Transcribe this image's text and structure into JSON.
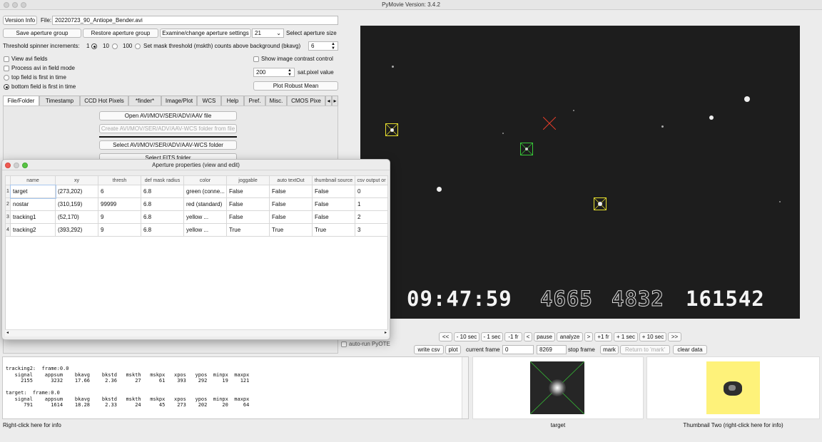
{
  "window": {
    "title": "PyMovie  Version: 3.4.2"
  },
  "top": {
    "version_info_btn": "Version Info",
    "file_label": "File:",
    "file_value": "20220723_90_Antiope_Bender.avi",
    "save_group_btn": "Save aperture group",
    "restore_group_btn": "Restore aperture group",
    "examine_btn": "Examine/change aperture settings",
    "aperture_size_value": "21",
    "aperture_size_label": "Select aperture size",
    "spinner_label": "Threshold spinner increments:",
    "spinner_options": [
      "1",
      "10",
      "100"
    ],
    "spinner_selected": "10",
    "mask_label": "Set mask threshold (mskth) counts above background (bkavg)",
    "mask_value": "6",
    "view_avi_fields": "View avi fields",
    "process_field_mode": "Process avi in field mode",
    "top_field_first": "top field is first in time",
    "bottom_field_first": "bottom field is first in time",
    "show_contrast": "Show image contrast control",
    "sat_value": "200",
    "sat_label": "sat.pixel value",
    "robust_mean_btn": "Plot Robust Mean"
  },
  "tabs": [
    "File/Folder",
    "Timestamp",
    "CCD Hot Pixels",
    "*finder*",
    "Image/Plot",
    "WCS",
    "Help",
    "Pref.",
    "Misc.",
    "CMOS Pixe"
  ],
  "file_panel": {
    "open_btn": "Open AVI/MOV/SER/ADV/AAV file",
    "create_btn": "Create AVI/MOV/SER/ADV/AAV-WCS folder from file",
    "select_btn": "Select AVI/MOV/SER/ADV/AAV-WCS folder",
    "select_fits_btn": "Select FITS folder"
  },
  "popup": {
    "title": "Aperture properties (view and edit)",
    "columns": [
      "name",
      "xy",
      "thresh",
      "def mask radius",
      "color",
      "joggable",
      "auto textOut",
      "thumbnail source",
      "csv output or"
    ],
    "rows": [
      [
        "target",
        "(273,202)",
        "6",
        "6.8",
        "green (conne...",
        "False",
        "False",
        "False",
        "0"
      ],
      [
        "nostar",
        "(310,159)",
        "99999",
        "6.8",
        "red (standard)",
        "False",
        "False",
        "False",
        "1"
      ],
      [
        "tracking1",
        "(52,170)",
        "9",
        "6.8",
        "yellow ...",
        "False",
        "False",
        "False",
        "2"
      ],
      [
        "tracking2",
        "(393,292)",
        "9",
        "6.8",
        "yellow ...",
        "True",
        "True",
        "True",
        "3"
      ]
    ]
  },
  "video": {
    "timestamp": "09:47:59",
    "ghost1": "4665",
    "ghost2": "4832",
    "counter": "161542"
  },
  "nav": {
    "buttons": [
      "<<",
      "- 10 sec",
      "- 1 sec",
      "-1 fr",
      "<",
      "pause",
      "analyze",
      ">",
      "+1 fr",
      "+ 1 sec",
      "+ 10 sec",
      ">>"
    ],
    "autorun_label": "auto-run PyOTE",
    "write_csv": "write csv",
    "plot": "plot",
    "current_frame_label": "current frame",
    "current_frame_value": "0",
    "stop_frame_value": "8269",
    "stop_frame_label": "stop frame",
    "mark": "mark",
    "return_mark": "Return to 'mark'",
    "clear_data": "clear data"
  },
  "console": {
    "lines": [
      "tracking2:  frame:0.0",
      "   signal    appsum    bkavg    bkstd   mskth   mskpx   xpos   ypos  minpx  maxpx",
      "     2155      3232    17.66     2.36      27      61    393    292     19    121",
      "",
      "target:  frame:0.0",
      "   signal    appsum    bkavg    bkstd   mskth   mskpx   xpos   ypos  minpx  maxpx",
      "      791      1614    18.28     2.33      24      45    273    202     20     64"
    ]
  },
  "status": {
    "left": "Right-click here for info",
    "thumb1_label": "target",
    "thumb2_label": "Thumbnail Two (right-click here for info)"
  },
  "colors": {
    "aperture_green": "#37c837",
    "aperture_red": "#e03c2a",
    "aperture_yellow": "#e8e02e",
    "thumbnail_two_bg": "#fef27a"
  }
}
